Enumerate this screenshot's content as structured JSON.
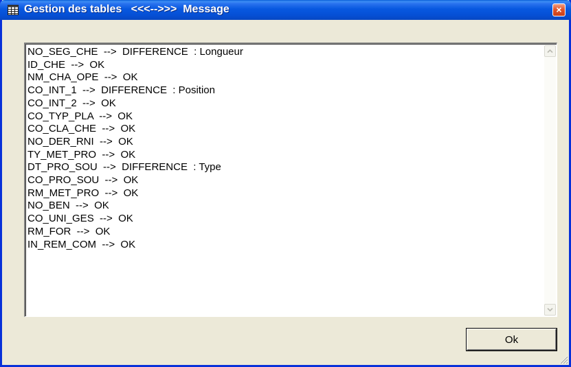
{
  "window": {
    "title": "Gestion des tables   <<<-->>>  Message",
    "icon": "table-icon",
    "close_label": "×"
  },
  "memo": {
    "lines": [
      "NO_SEG_CHE  -->  DIFFERENCE  : Longueur",
      "ID_CHE  -->  OK",
      "NM_CHA_OPE  -->  OK",
      "CO_INT_1  -->  DIFFERENCE  : Position",
      "CO_INT_2  -->  OK",
      "CO_TYP_PLA  -->  OK",
      "CO_CLA_CHE  -->  OK",
      "NO_DER_RNI  -->  OK",
      "TY_MET_PRO  -->  OK",
      "DT_PRO_SOU  -->  DIFFERENCE  : Type",
      "CO_PRO_SOU  -->  OK",
      "RM_MET_PRO  -->  OK",
      "NO_BEN  -->  OK",
      "CO_UNI_GES  -->  OK",
      "RM_FOR  -->  OK",
      "IN_REM_COM  -->  OK"
    ]
  },
  "buttons": {
    "ok_label": "Ok"
  },
  "colors": {
    "titlebar": "#0858e0",
    "frame": "#0831d9",
    "face": "#ece9d8",
    "close": "#e2552c"
  }
}
